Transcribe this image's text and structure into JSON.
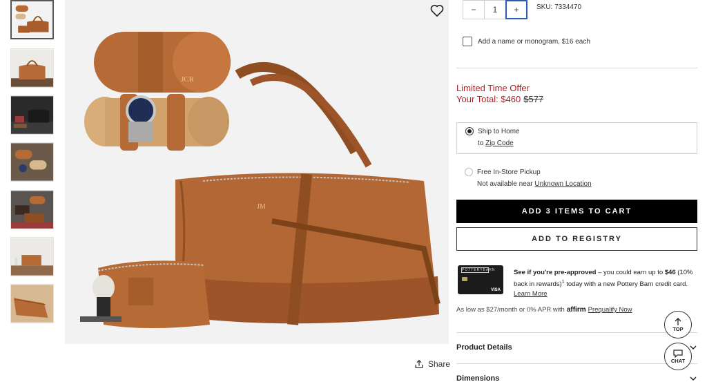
{
  "gallery": {
    "thumbnail_count": 7,
    "active_index": 0
  },
  "product_image": {
    "monogram_case": "JCR",
    "monogram_bag": "JM"
  },
  "quantity": {
    "minus": "−",
    "value": "1",
    "plus": "+"
  },
  "sku": "SKU: 7334470",
  "monogram": {
    "label": "Add a name or monogram, $16 each"
  },
  "price": {
    "offer_label": "Limited Time Offer",
    "total_label": "Your Total: $460",
    "was_price": "$577"
  },
  "shipping": {
    "ship_label": "Ship to Home",
    "to_label": "to",
    "zip_link": "Zip Code",
    "pickup_label": "Free In-Store Pickup",
    "pickup_note": "Not available near",
    "pickup_location_link": "Unknown Location"
  },
  "buttons": {
    "add_to_cart": "ADD 3 ITEMS TO CART",
    "add_to_registry": "ADD TO REGISTRY"
  },
  "card_promo": {
    "brand": "POTTERYBARN",
    "card_network": "VISA",
    "bold_intro": "See if you're pre-approved",
    "text_1": " – you could earn up to ",
    "amount": "$46",
    "text_2": " (10% back in rewards)",
    "superscript": "1",
    "text_3": " today with a new Pottery Barn credit card. ",
    "learn_more": "Learn More"
  },
  "affirm": {
    "text": "As low as $27/month or 0% APR with",
    "logo": "affirm",
    "link": "Prequalify Now"
  },
  "accordion": {
    "product_details": "Product Details",
    "dimensions": "Dimensions"
  },
  "share": {
    "label": "Share"
  },
  "floating": {
    "top": "TOP",
    "chat": "CHAT"
  },
  "colors": {
    "price_red": "#b81d22",
    "leather": "#b66a35",
    "primary_button": "#000000",
    "focus_blue": "#2a5db0"
  }
}
